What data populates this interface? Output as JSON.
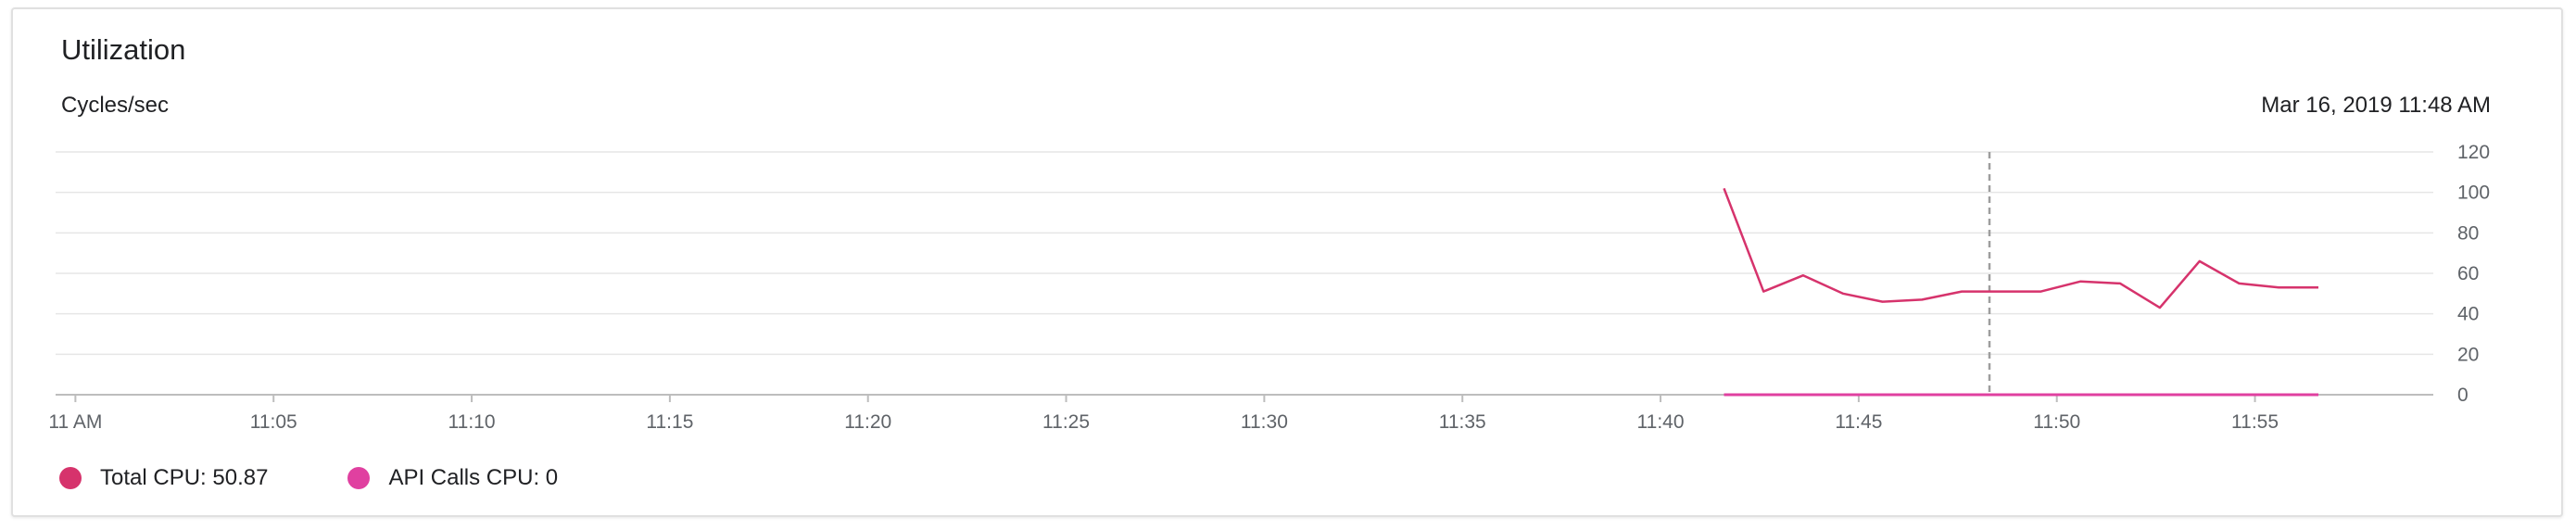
{
  "card": {
    "title": "Utilization",
    "unit_label": "Cycles/sec",
    "timestamp": "Mar 16, 2019 11:48 AM"
  },
  "legend": [
    {
      "label": "Total CPU: 50.87",
      "color": "#d6336c"
    },
    {
      "label": "API Calls CPU: 0",
      "color": "#e040a0"
    }
  ],
  "chart_data": {
    "type": "line",
    "title": "Utilization",
    "ylabel": "Cycles/sec",
    "xlabel": "",
    "ylim": [
      0,
      120
    ],
    "yticks": [
      "0",
      "20",
      "40",
      "60",
      "80",
      "100",
      "120"
    ],
    "xlim_minutes": [
      -0.5,
      59.5
    ],
    "xticks": [
      {
        "label": "11 AM",
        "minute": 0
      },
      {
        "label": "11:05",
        "minute": 5
      },
      {
        "label": "11:10",
        "minute": 10
      },
      {
        "label": "11:15",
        "minute": 15
      },
      {
        "label": "11:20",
        "minute": 20
      },
      {
        "label": "11:25",
        "minute": 25
      },
      {
        "label": "11:30",
        "minute": 30
      },
      {
        "label": "11:35",
        "minute": 35
      },
      {
        "label": "11:40",
        "minute": 40
      },
      {
        "label": "11:45",
        "minute": 45
      },
      {
        "label": "11:50",
        "minute": 50
      },
      {
        "label": "11:55",
        "minute": 55
      }
    ],
    "cursor_minute": 48.3,
    "grid": true,
    "legend_position": "bottom-left",
    "series": [
      {
        "name": "Total CPU",
        "color": "#d6336c",
        "x": [
          41.6,
          42.6,
          43.6,
          44.6,
          45.6,
          46.6,
          47.6,
          48.6,
          49.6,
          50.6,
          51.6,
          52.6,
          53.6,
          54.6,
          55.6,
          56.6
        ],
        "y": [
          102,
          51,
          59,
          50,
          46,
          47,
          51,
          51,
          51,
          56,
          55,
          43,
          66,
          55,
          53,
          53
        ]
      },
      {
        "name": "API Calls CPU",
        "color": "#e040a0",
        "x": [
          41.6,
          42.6,
          43.6,
          44.6,
          45.6,
          46.6,
          47.6,
          48.6,
          49.6,
          50.6,
          51.6,
          52.6,
          53.6,
          54.6,
          55.6,
          56.6
        ],
        "y": [
          0,
          0,
          0,
          0,
          0,
          0,
          0,
          0,
          0,
          0,
          0,
          0,
          0,
          0,
          0,
          0
        ]
      }
    ]
  }
}
